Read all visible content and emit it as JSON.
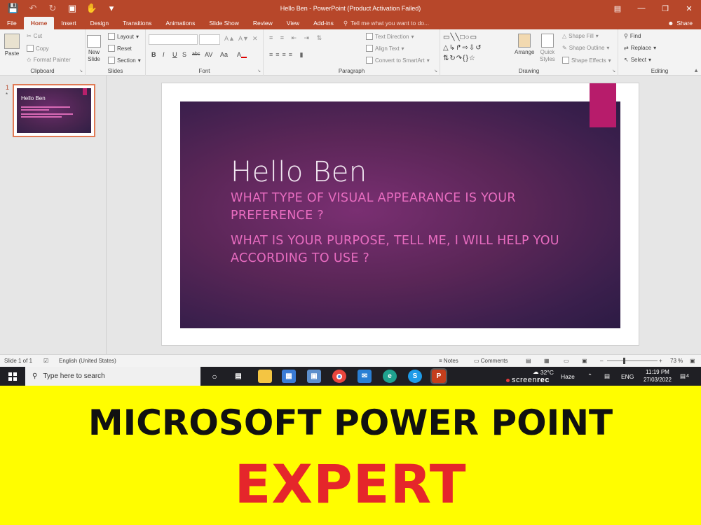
{
  "window": {
    "title": "Hello Ben - PowerPoint (Product Activation Failed)"
  },
  "tabs": [
    {
      "label": "File"
    },
    {
      "label": "Home",
      "active": true
    },
    {
      "label": "Insert"
    },
    {
      "label": "Design"
    },
    {
      "label": "Transitions"
    },
    {
      "label": "Animations"
    },
    {
      "label": "Slide Show"
    },
    {
      "label": "Review"
    },
    {
      "label": "View"
    },
    {
      "label": "Add-ins"
    }
  ],
  "tell_me": "Tell me what you want to do...",
  "share_label": "Share",
  "ribbon": {
    "clipboard": {
      "paste": "Paste",
      "cut": "Cut",
      "copy": "Copy",
      "format_painter": "Format Painter",
      "label": "Clipboard"
    },
    "slides": {
      "new_slide_1": "New",
      "new_slide_2": "Slide",
      "layout": "Layout",
      "reset": "Reset",
      "section": "Section",
      "label": "Slides"
    },
    "font": {
      "label": "Font",
      "aa": "Aa"
    },
    "paragraph": {
      "text_direction": "Text Direction",
      "align_text": "Align Text",
      "convert_smartart": "Convert to SmartArt",
      "label": "Paragraph"
    },
    "drawing": {
      "arrange": "Arrange",
      "quick_styles_1": "Quick",
      "quick_styles_2": "Styles",
      "shape_fill": "Shape Fill",
      "shape_outline": "Shape Outline",
      "shape_effects": "Shape Effects",
      "label": "Drawing"
    },
    "editing": {
      "find": "Find",
      "replace": "Replace",
      "select": "Select",
      "label": "Editing"
    }
  },
  "thumbnail": {
    "number": "1",
    "star": "*",
    "title": "Hello Ben"
  },
  "slide": {
    "title": "Hello Ben",
    "body_1": "WHAT TYPE OF VISUAL APPEARANCE IS YOUR PREFERENCE ?",
    "body_2": "WHAT IS YOUR PURPOSE, TELL ME, I WILL HELP YOU ACCORDING TO USE ?",
    "accent_color": "#b71c6b",
    "title_color": "#f2e8f2",
    "body_color": "#e86cc0"
  },
  "statusbar": {
    "slide_count": "Slide 1 of 1",
    "language": "English (United States)",
    "notes": "Notes",
    "comments": "Comments",
    "zoom": "73 %"
  },
  "taskbar": {
    "search_placeholder": "Type here to search",
    "weather_temp": "32°C",
    "weather_desc": "Haze",
    "language": "ENG",
    "time": "11:19 PM",
    "date": "27/03/2022",
    "notification_count": "4",
    "screenrec_1": "screen",
    "screenrec_2": "rec"
  },
  "banner": {
    "line1": "MICROSOFT POWER POINT",
    "line2": "EXPERT",
    "background": "#fffd00",
    "line1_color": "#111111",
    "line2_color": "#e5262b"
  },
  "colors": {
    "accent": "#b7472a"
  }
}
